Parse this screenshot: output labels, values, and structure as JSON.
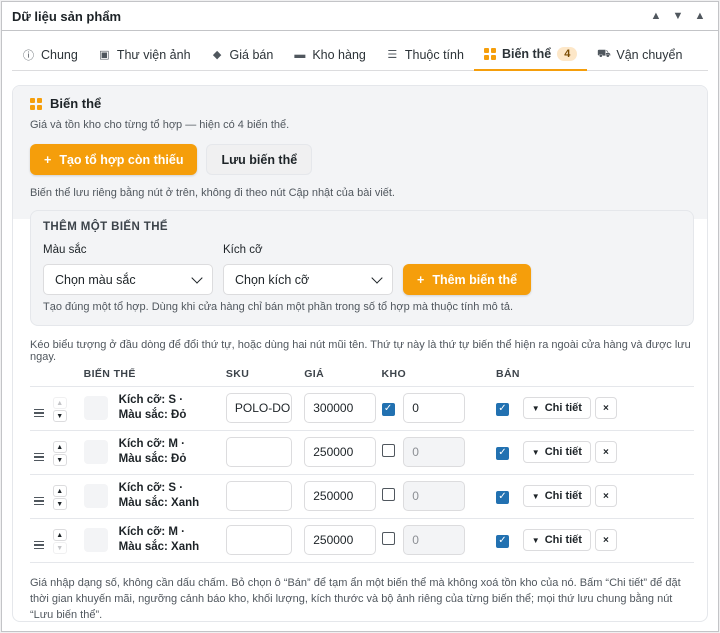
{
  "metabox": {
    "title": "Dữ liệu sản phẩm"
  },
  "tabs": [
    {
      "label": "Chung",
      "icon": "info-icon"
    },
    {
      "label": "Thư viện ảnh",
      "icon": "gallery-icon"
    },
    {
      "label": "Giá bán",
      "icon": "price-tag-icon"
    },
    {
      "label": "Kho hàng",
      "icon": "inventory-icon"
    },
    {
      "label": "Thuộc tính",
      "icon": "list-icon"
    },
    {
      "label": "Biến thể",
      "icon": "grid-icon",
      "badge": "4",
      "active": true
    },
    {
      "label": "Vận chuyển",
      "icon": "car-icon"
    }
  ],
  "variations": {
    "title": "Biến thể",
    "description": "Giá và tồn kho cho từng tổ hợp — hiện có 4 biến thể.",
    "create_missing": "Tạo tổ hợp còn thiếu",
    "save": "Lưu biến thể",
    "save_note": "Biến thể lưu riêng bằng nút ở trên, không đi theo nút Cập nhật của bài viết.",
    "add": {
      "title": "THÊM MỘT BIẾN THỂ",
      "color_label": "Màu sắc",
      "color_value": "Chọn màu sắc",
      "size_label": "Kích cỡ",
      "size_value": "Chọn kích cỡ",
      "add_button": "Thêm biến thể",
      "note": "Tạo đúng một tổ hợp. Dùng khi cửa hàng chỉ bán một phần trong số tổ hợp mà thuộc tính mô tả."
    },
    "drag_note": "Kéo biểu tượng ở đầu dòng để đổi thứ tự, hoặc dùng hai nút mũi tên. Thứ tự này là thứ tự biến thể hiện ra ngoài cửa hàng và được lưu ngay.",
    "columns": {
      "variant": "BIẾN THỂ",
      "sku": "SKU",
      "price": "GIÁ",
      "stock": "KHO",
      "sell": "BÁN"
    },
    "rows": [
      {
        "name": "Kích cỡ: S · Màu sắc: Đỏ",
        "sku": "POLO-DO",
        "price": "300000",
        "stock_managed": true,
        "stock": "0",
        "sell": true
      },
      {
        "name": "Kích cỡ: M · Màu sắc: Đỏ",
        "sku": "",
        "price": "250000",
        "stock_managed": false,
        "stock": "0",
        "sell": true
      },
      {
        "name": "Kích cỡ: S · Màu sắc: Xanh",
        "sku": "",
        "price": "250000",
        "stock_managed": false,
        "stock": "0",
        "sell": true
      },
      {
        "name": "Kích cỡ: M · Màu sắc: Xanh",
        "sku": "",
        "price": "250000",
        "stock_managed": false,
        "stock": "0",
        "sell": true
      }
    ],
    "detail_label": "Chi tiết",
    "remove_label": "×",
    "footer": "Giá nhập dạng số, không cần dấu chấm. Bỏ chọn ô “Bán” để tạm ẩn một biến thể mà không xoá tồn kho của nó. Bấm “Chi tiết” để đặt thời gian khuyến mãi, ngưỡng cảnh báo kho, khối lượng, kích thước và bộ ảnh riêng của từng biến thể; mọi thứ lưu chung bằng nút “Lưu biến thể”."
  },
  "colors": {
    "accent": "#f59e0b",
    "checkbox": "#2271b1"
  }
}
